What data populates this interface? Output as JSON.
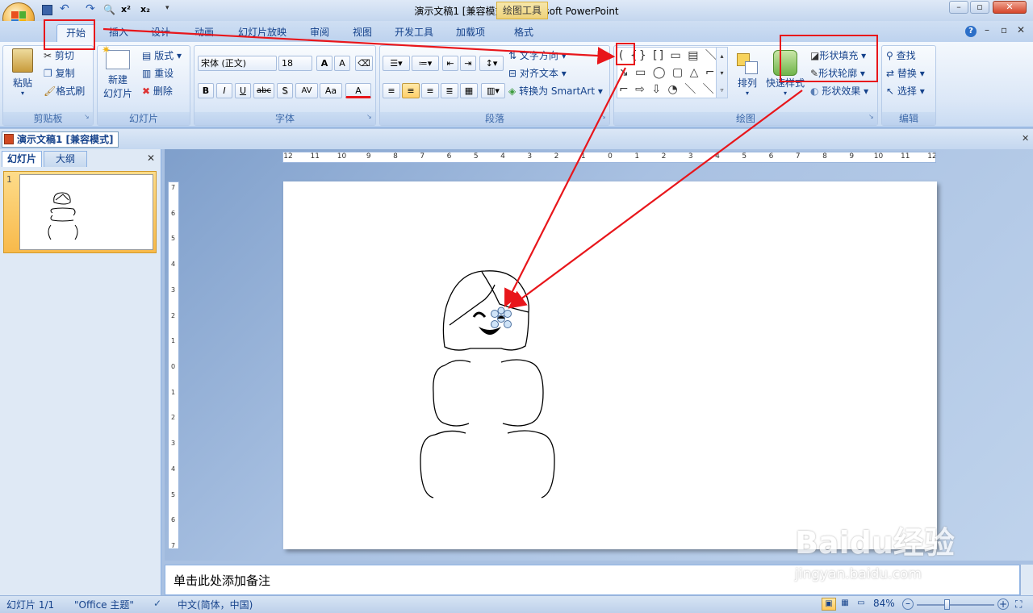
{
  "window": {
    "title": "演示文稿1 [兼容模式] - Microsoft PowerPoint",
    "context_tab": "绘图工具",
    "min": "–",
    "max": "▫",
    "close": "✕"
  },
  "tabs": [
    "开始",
    "插入",
    "设计",
    "动画",
    "幻灯片放映",
    "审阅",
    "视图",
    "开发工具",
    "加载项",
    "格式"
  ],
  "clipboard": {
    "paste": "粘贴",
    "cut": "剪切",
    "copy": "复制",
    "format_painter": "格式刷",
    "label": "剪贴板"
  },
  "slides_group": {
    "new_slide": "新建",
    "new_slide2": "幻灯片",
    "layout": "版式",
    "reset": "重设",
    "delete": "删除",
    "label": "幻灯片"
  },
  "font": {
    "name": "宋体 (正文)",
    "size": "18",
    "grow": "A",
    "shrink": "A",
    "bold": "B",
    "italic": "I",
    "underline": "U",
    "strike": "abc",
    "shadow": "S",
    "spacing": "AV",
    "case": "Aa",
    "color": "A",
    "label": "字体"
  },
  "paragraph": {
    "text_direction": "文字方向",
    "align_text": "对齐文本",
    "smartart": "转换为 SmartArt",
    "label": "段落"
  },
  "drawing": {
    "arrange": "排列",
    "quick_styles": "快速样式",
    "fill": "形状填充",
    "outline": "形状轮廓",
    "effects": "形状效果",
    "label": "绘图"
  },
  "editing": {
    "find": "查找",
    "replace": "替换",
    "select": "选择",
    "label": "编辑"
  },
  "doc_tab": "演示文稿1 [兼容模式]",
  "left_tabs": {
    "slides": "幻灯片",
    "outline": "大纲",
    "close": "✕",
    "slide_num": "1"
  },
  "ruler_h": [
    "12",
    "11",
    "10",
    "9",
    "8",
    "7",
    "6",
    "5",
    "4",
    "3",
    "2",
    "1",
    "0",
    "1",
    "2",
    "3",
    "4",
    "5",
    "6",
    "7",
    "8",
    "9",
    "10",
    "11",
    "12"
  ],
  "ruler_v": [
    "7",
    "6",
    "5",
    "4",
    "3",
    "2",
    "1",
    "0",
    "1",
    "2",
    "3",
    "4",
    "5",
    "6",
    "7"
  ],
  "notes": "单击此处添加备注",
  "status": {
    "slide": "幻灯片 1/1",
    "theme": "\"Office 主题\"",
    "lang": "中文(简体，中国)",
    "zoom": "84%"
  },
  "watermark": {
    "text": "Baidu经验",
    "url": "jingyan.baidu.com"
  }
}
